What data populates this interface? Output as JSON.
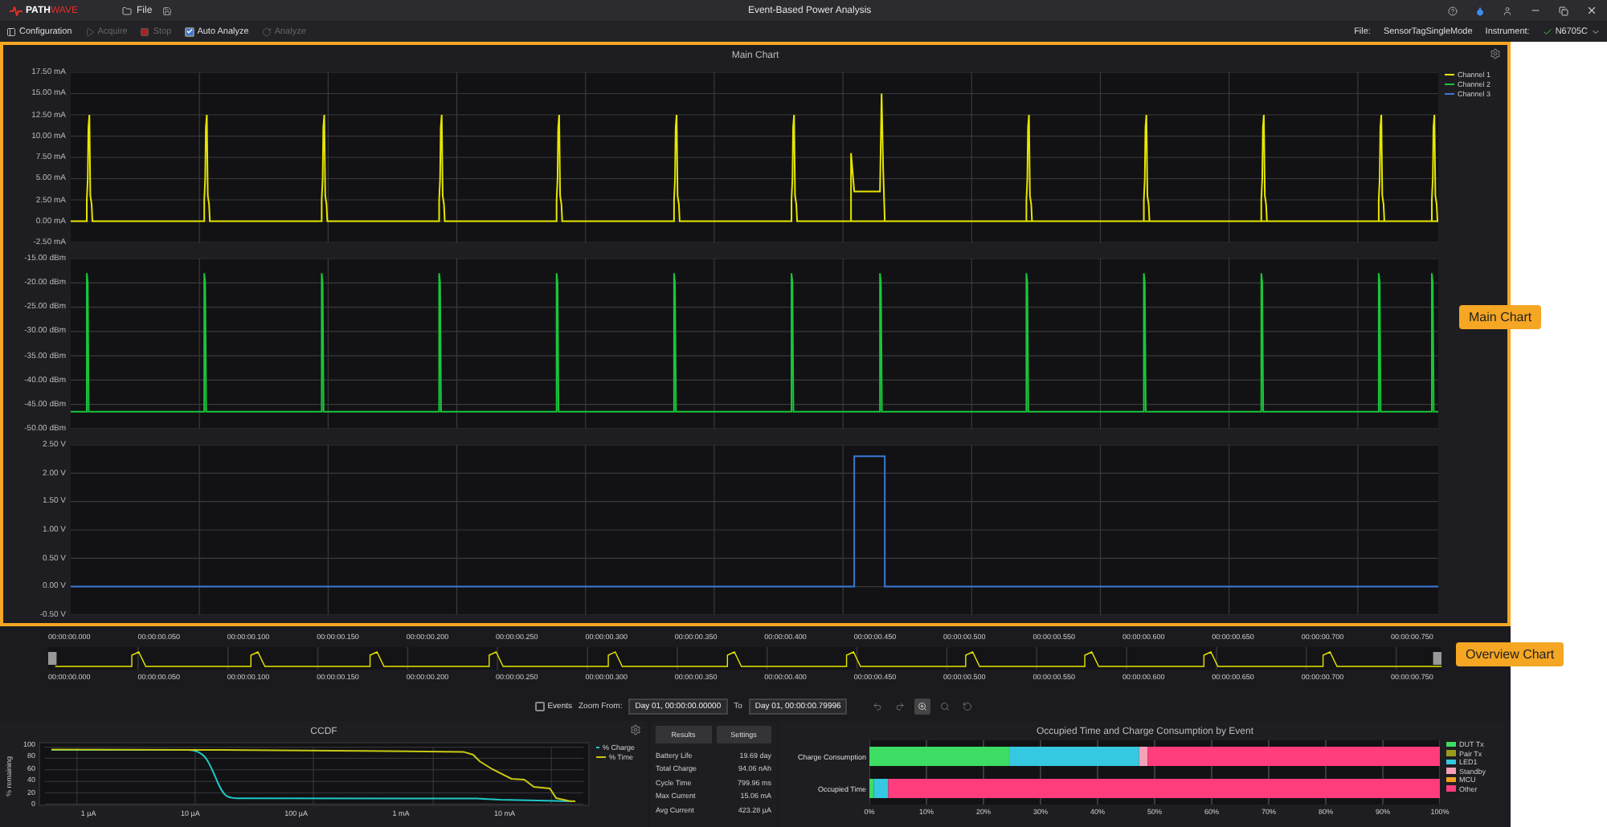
{
  "window": {
    "logo": [
      "PATH",
      "WAVE"
    ],
    "title": "Event-Based Power Analysis",
    "menu": [
      {
        "label": "File"
      }
    ]
  },
  "toolbar": {
    "items": [
      {
        "kind": "button",
        "label": "Configuration",
        "disabled": false
      },
      {
        "kind": "button",
        "label": "Acquire",
        "disabled": true
      },
      {
        "kind": "button",
        "label": "Stop",
        "disabled": true
      },
      {
        "kind": "checkbox",
        "label": "Auto Analyze",
        "checked": true
      },
      {
        "kind": "button",
        "label": "Analyze",
        "disabled": true
      }
    ],
    "file_label": "File:",
    "file_value": "SensorTagSingleMode",
    "instrument_label": "Instrument:",
    "instrument_value": "N6705C"
  },
  "main_chart": {
    "title": "Main Chart",
    "panels": [
      {
        "kind": "current",
        "ticks": [
          "17.50 mA",
          "15.00 mA",
          "12.50 mA",
          "10.00 mA",
          "7.50 mA",
          "5.00 mA",
          "2.50 mA",
          "0.00 mA",
          "-2.50 mA"
        ]
      },
      {
        "kind": "power",
        "ticks": [
          "-15.00 dBm",
          "-20.00 dBm",
          "-25.00 dBm",
          "-30.00 dBm",
          "-35.00 dBm",
          "-40.00 dBm",
          "-45.00 dBm",
          "-50.00 dBm"
        ]
      },
      {
        "kind": "voltage",
        "ticks": [
          "2.50 V",
          "2.00 V",
          "1.50 V",
          "1.00 V",
          "0.50 V",
          "0.00 V",
          "-0.50 V"
        ]
      }
    ],
    "legend": [
      {
        "label": "Channel 1",
        "color": "#e6e600"
      },
      {
        "label": "Channel 2",
        "color": "#19c63a"
      },
      {
        "label": "Channel 3",
        "color": "#3a78d8"
      }
    ]
  },
  "overview": {
    "top_labels": [
      "00:00:00.000",
      "00:00:00.050",
      "00:00:00.100",
      "00:00:00.150",
      "00:00:00.200",
      "00:00:00.250",
      "00:00:00.300",
      "00:00:00.350",
      "00:00:00.400",
      "00:00:00.450",
      "00:00:00.500",
      "00:00:00.550",
      "00:00:00.600",
      "00:00:00.650",
      "00:00:00.700",
      "00:00:00.750"
    ],
    "bottom_labels": [
      "00:00:00.000",
      "00:00:00.050",
      "00:00:00.100",
      "00:00:00.150",
      "00:00:00.200",
      "00:00:00.250",
      "00:00:00.300",
      "00:00:00.350",
      "00:00:00.400",
      "00:00:00.450",
      "00:00:00.500",
      "00:00:00.550",
      "00:00:00.600",
      "00:00:00.650",
      "00:00:00.700",
      "00:00:00.750"
    ]
  },
  "zoom_bar": {
    "events": {
      "label": "Events",
      "checked": false
    },
    "from_label": "Zoom From:",
    "from_value": "Day 01, 00:00:00.00000",
    "to_label": "To",
    "to_value": "Day 01, 00:00:00.79996",
    "tools": [
      {
        "disabled": true,
        "selected": false
      },
      {
        "disabled": true,
        "selected": false
      },
      {
        "disabled": false,
        "selected": true
      },
      {
        "disabled": true,
        "selected": false
      },
      {
        "disabled": true,
        "selected": false
      }
    ]
  },
  "ccdf": {
    "title": "CCDF",
    "ylabel": "% remaining",
    "yticks": [
      "100",
      "80",
      "60",
      "40",
      "20",
      "0"
    ],
    "xticks": [
      "1 µA",
      "10 µA",
      "100 µA",
      "1 mA",
      "10 mA"
    ],
    "legend": [
      {
        "label": "% Charge",
        "color": "#1fc8c8"
      },
      {
        "label": "% Time",
        "color": "#c8c814"
      }
    ]
  },
  "results": {
    "buttons": [
      "Results",
      "Settings"
    ],
    "rows": [
      {
        "label": "Battery Life",
        "value": "19.69 day"
      },
      {
        "label": "Total Charge",
        "value": "94.06 nAh"
      },
      {
        "label": "Cycle Time",
        "value": "799.96 ms"
      },
      {
        "label": "Max Current",
        "value": "15.06 mA"
      },
      {
        "label": "Avg Current",
        "value": "423.28 µA"
      }
    ]
  },
  "occupancy": {
    "chart_data": {
      "type": "bar",
      "orientation": "horizontal",
      "stacked": true,
      "title": "Occupied Time and Charge Consumption by Event",
      "categories": [
        "Charge Consumption",
        "Occupied Time"
      ],
      "series": [
        {
          "name": "DUT Tx",
          "color": "#3ddc64",
          "values": [
            24.5,
            0.8
          ]
        },
        {
          "name": "Pair Tx",
          "color": "#9a9a20",
          "values": [
            0,
            0
          ]
        },
        {
          "name": "LED1",
          "color": "#35c8e0",
          "values": [
            22.8,
            2.5
          ]
        },
        {
          "name": "Standby",
          "color": "#f4a0b8",
          "values": [
            1.5,
            0
          ]
        },
        {
          "name": "MCU",
          "color": "#f0a020",
          "values": [
            0,
            0
          ]
        },
        {
          "name": "Other",
          "color": "#ff3c7c",
          "values": [
            51.2,
            96.7
          ]
        }
      ],
      "xlim": [
        0,
        100
      ],
      "grid": true,
      "legend": "right",
      "xticks": [
        {
          "value": 0,
          "label": "0%"
        },
        {
          "value": 10,
          "label": "10%"
        },
        {
          "value": 20,
          "label": "20%"
        },
        {
          "value": 30,
          "label": "30%"
        },
        {
          "value": 40,
          "label": "40%"
        },
        {
          "value": 50,
          "label": "50%"
        },
        {
          "value": 60,
          "label": "60%"
        },
        {
          "value": 70,
          "label": "70%"
        },
        {
          "value": 80,
          "label": "80%"
        },
        {
          "value": 90,
          "label": "90%"
        },
        {
          "value": 100,
          "label": "100%"
        }
      ]
    }
  },
  "callouts": [
    {
      "label": "Main Chart"
    },
    {
      "label": "Overview Chart"
    }
  ]
}
